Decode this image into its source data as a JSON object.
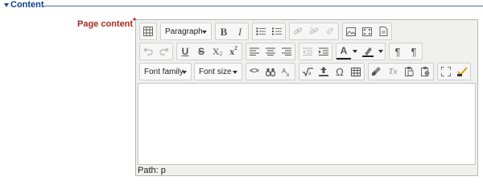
{
  "section": {
    "title": "Content"
  },
  "field": {
    "label": "Page content",
    "required_mark": "*"
  },
  "toolbar": {
    "paragraph_select": "Paragraph",
    "font_family_select": "Font family",
    "font_size_select": "Font size",
    "bold": "B",
    "italic": "I",
    "underline": "U",
    "strike": "S",
    "subscript": "X",
    "subscript_mark": "2",
    "superscript": "x",
    "superscript_mark": "2",
    "text_color": "A",
    "ltr": "¶",
    "rtl": "¶",
    "omega": "Ω",
    "code": "<>",
    "clear_format": "Tx"
  },
  "status_bar": {
    "path": "Path: p"
  },
  "colors": {
    "legend": "#0b3f8a",
    "label": "#a52a1e",
    "required": "#cc0000"
  }
}
